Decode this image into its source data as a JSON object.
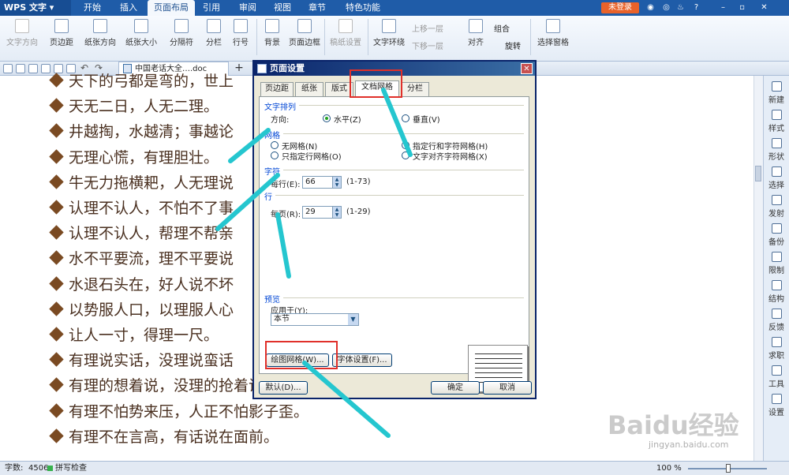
{
  "app": {
    "name": "WPS 文字",
    "login_label": "未登录"
  },
  "menu_tabs": [
    "开始",
    "插入",
    "页面布局",
    "引用",
    "审阅",
    "视图",
    "章节",
    "特色功能"
  ],
  "active_menu_tab": "页面布局",
  "toolbar": {
    "items": [
      "文字方向",
      "页边距",
      "纸张方向",
      "纸张大小",
      "分隔符",
      "分栏",
      "行号",
      "背景",
      "页面边框",
      "稿纸设置",
      "文字环绕",
      "对齐",
      "选择窗格"
    ],
    "small_items": [
      "上移一层",
      "下移一层",
      "组合",
      "旋转"
    ]
  },
  "document_tab": {
    "title": "中国老话大全….doc",
    "close": "×",
    "new_tab": "+"
  },
  "document_lines": [
    "天下的弓都是弯的，世上",
    "天无二日，人无二理。",
    "井越掏，水越清；事越论",
    "无理心慌，有理胆壮。",
    "牛无力拖横耙，人无理说",
    "认理不认人，不怕不了事",
    "认理不认人，帮理不帮亲",
    "水不平要流，理不平要说",
    "水退石头在，好人说不坏",
    "以势服人口，以理服人心",
    "让人一寸，得理一尺。",
    "有理说实话，没理说蛮话",
    "有理的想着说，没理的抢着说",
    "有理不怕势来压，人正不怕影子歪。",
    "有理不在言高，有话说在面前。"
  ],
  "sidebar": [
    "新建",
    "样式",
    "形状",
    "选择",
    "发射",
    "备份",
    "限制",
    "结构",
    "反馈",
    "求职",
    "工具",
    "设置"
  ],
  "status": {
    "word_count_label": "字数:",
    "word_count": "4506",
    "spell_check": "拼写检查",
    "zoom": "100 %"
  },
  "dialog": {
    "title": "页面设置",
    "close": "✕",
    "tabs": [
      "页边距",
      "纸张",
      "版式",
      "文档网格",
      "分栏"
    ],
    "active_tab": "文档网格",
    "text_direction": {
      "group": "文字排列",
      "label": "方向:",
      "horizontal": "水平(Z)",
      "vertical": "垂直(V)",
      "selected": "水平(Z)"
    },
    "grid": {
      "group": "网格",
      "options": [
        "无网格(N)",
        "只指定行网格(O)",
        "指定行和字符网格(H)",
        "文字对齐字符网格(X)"
      ],
      "selected": "指定行和字符网格(H)"
    },
    "chars": {
      "group": "字符",
      "label": "每行(E):",
      "value": "66",
      "range": "(1-73)"
    },
    "lines": {
      "group": "行",
      "label": "每页(R):",
      "value": "29",
      "range": "(1-29)"
    },
    "preview": {
      "group": "预览",
      "apply_label": "应用于(Y):",
      "apply_value": "本节"
    },
    "buttons": {
      "draw_grid": "绘图网格(W)...",
      "font_settings": "字体设置(F)...",
      "default": "默认(D)...",
      "ok": "确定",
      "cancel": "取消"
    }
  },
  "watermark": {
    "brand": "Baidu经验",
    "url": "jingyan.baidu.com"
  }
}
